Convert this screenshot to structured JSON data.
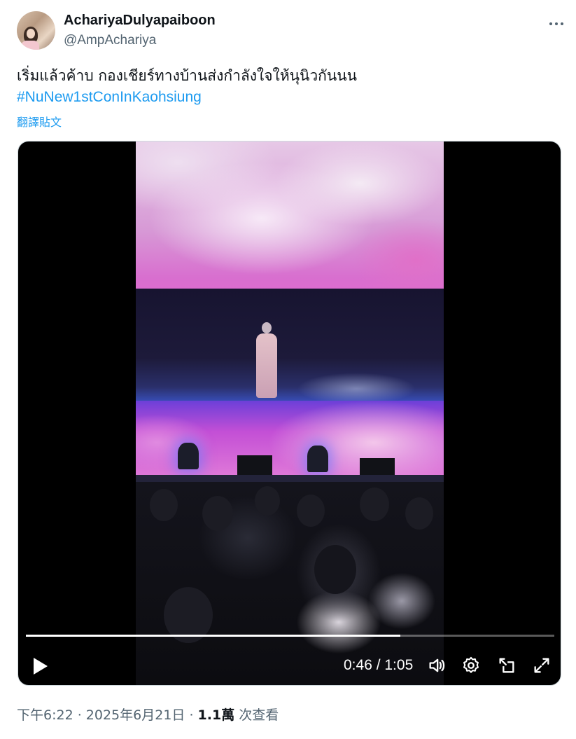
{
  "author": {
    "display_name": "AchariyaDulyapaiboon",
    "handle": "@AmpAchariya"
  },
  "tweet": {
    "text": "เริ่มแล้วค้าบ กองเชียร์ทางบ้านส่งกำลังใจให้นุนิวกันนน",
    "hashtag": "#NuNew1stConInKaohsiung",
    "translate_label": "翻譯貼文"
  },
  "video": {
    "current_time": "0:46",
    "duration": "1:05",
    "time_display": "0:46 / 1:05",
    "progress_fraction": 0.708,
    "icons": [
      "play-icon",
      "volume-icon",
      "settings-icon",
      "picture-in-picture-icon",
      "fullscreen-icon"
    ]
  },
  "meta": {
    "timestamp": "下午6:22 · 2025年6月21日 · ",
    "views_count": "1.1萬",
    "views_label": " 次查看"
  },
  "colors": {
    "link": "#1d9bf0",
    "secondary_text": "#536471",
    "primary_text": "#0f1419"
  }
}
